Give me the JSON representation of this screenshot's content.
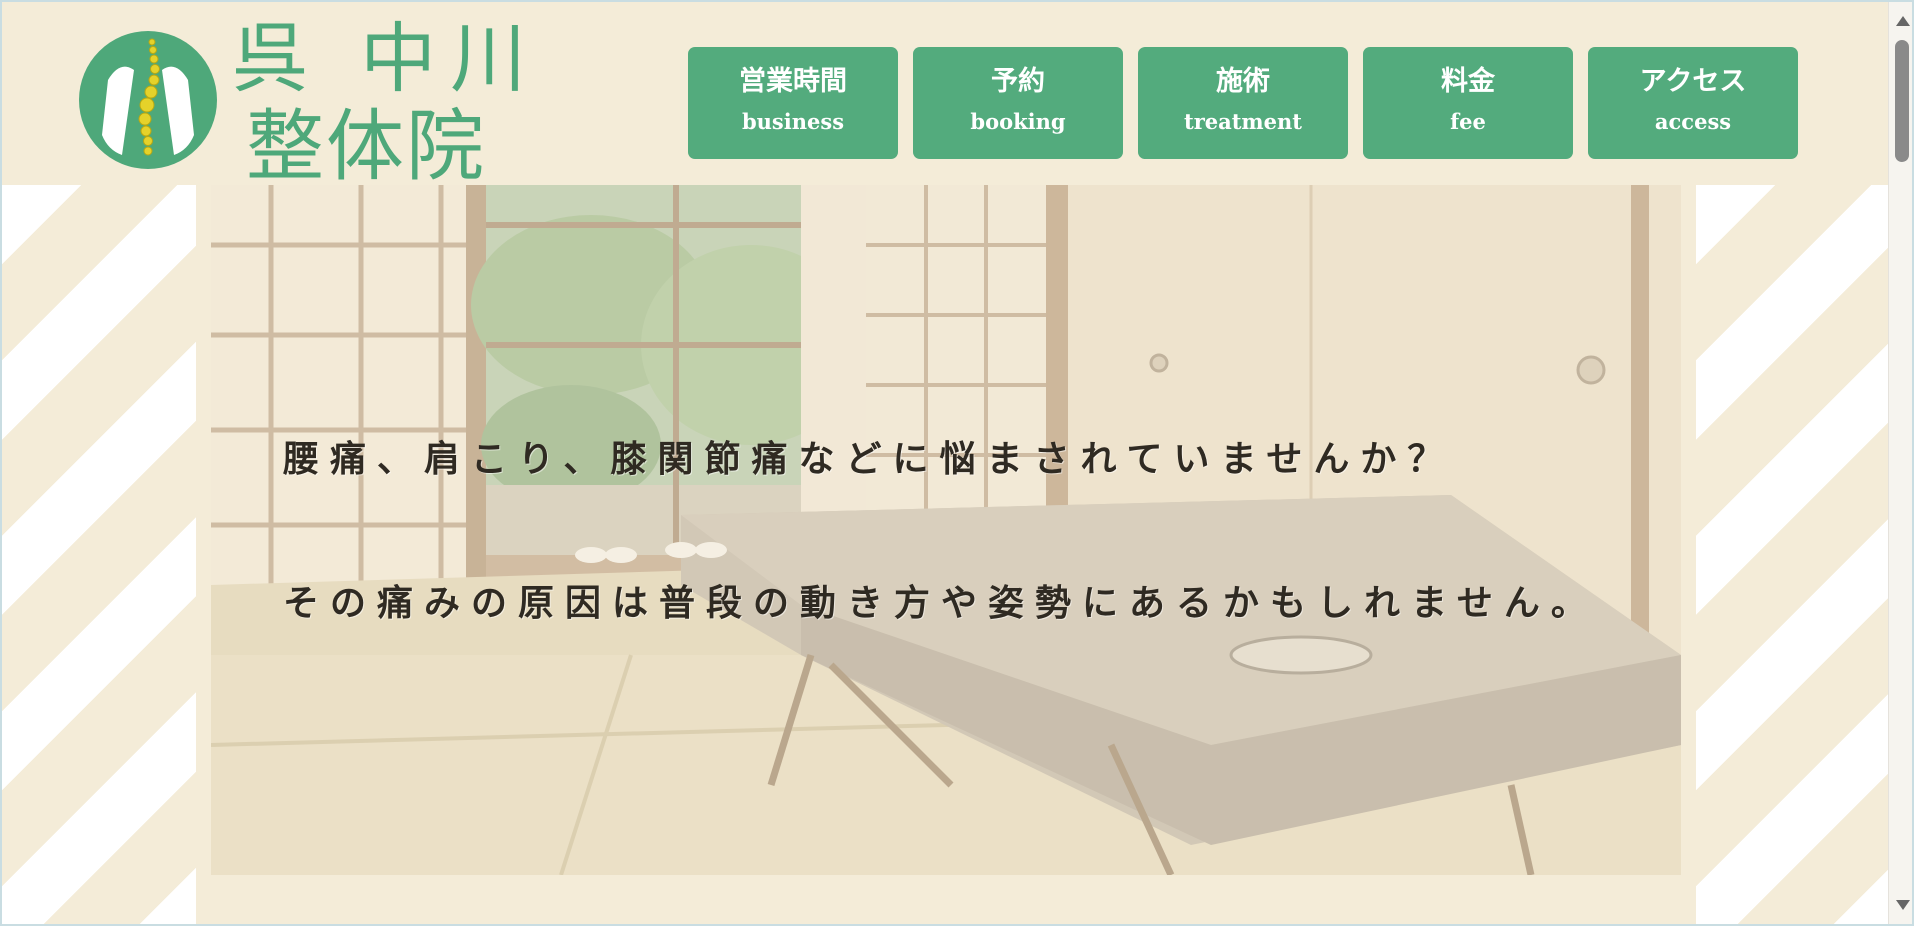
{
  "brand": {
    "name_top": "呉 中川",
    "name_bottom": "整体院",
    "color": "#4ea87a"
  },
  "nav": [
    {
      "ja": "営業時間",
      "en": "business"
    },
    {
      "ja": "予約",
      "en": "booking"
    },
    {
      "ja": "施術",
      "en": "treatment"
    },
    {
      "ja": "料金",
      "en": "fee"
    },
    {
      "ja": "アクセス",
      "en": "access"
    }
  ],
  "hero": {
    "line1": "腰痛、肩こり、膝関節痛などに悩まされていませんか？",
    "line2": "その痛みの原因は普段の動き方や姿勢にあるかもしれません。"
  },
  "colors": {
    "background": "#f4ecd8",
    "nav_button": "#53ab7d",
    "stripe": "#ffffff"
  }
}
